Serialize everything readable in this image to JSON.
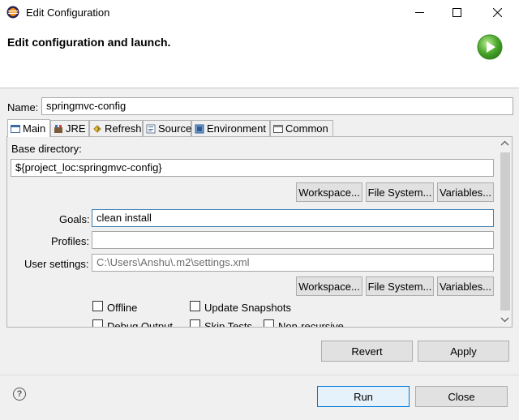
{
  "window": {
    "title": "Edit Configuration",
    "controls": {
      "minimize": "—",
      "maximize": "☐",
      "close": "✕"
    }
  },
  "header": {
    "title": "Edit configuration and launch."
  },
  "name": {
    "label": "Name:",
    "value": "springmvc-config"
  },
  "tabs": [
    {
      "label": "Main",
      "icon": "main-tab-icon"
    },
    {
      "label": "JRE",
      "icon": "jre-icon"
    },
    {
      "label": "Refresh",
      "icon": "refresh-icon"
    },
    {
      "label": "Source",
      "icon": "source-icon"
    },
    {
      "label": "Environment",
      "icon": "environment-icon"
    },
    {
      "label": "Common",
      "icon": "common-icon"
    }
  ],
  "main": {
    "base_directory": {
      "label": "Base directory:",
      "value": "${project_loc:springmvc-config}"
    },
    "buttons_row1": {
      "workspace": "Workspace...",
      "file_system": "File System...",
      "variables": "Variables..."
    },
    "goals": {
      "label": "Goals:",
      "value": "clean install"
    },
    "profiles": {
      "label": "Profiles:",
      "value": ""
    },
    "user_settings": {
      "label": "User settings:",
      "value": "C:\\Users\\Anshu\\.m2\\settings.xml"
    },
    "buttons_row2": {
      "workspace": "Workspace...",
      "file_system": "File System...",
      "variables": "Variables..."
    },
    "checkboxes": {
      "offline": "Offline",
      "update_snapshots": "Update Snapshots",
      "debug_output": "Debug Output",
      "skip_tests": "Skip Tests",
      "non_recursive": "Non-recursive"
    }
  },
  "actions": {
    "revert": "Revert",
    "apply": "Apply"
  },
  "footer": {
    "help": "?",
    "run": "Run",
    "close": "Close"
  }
}
